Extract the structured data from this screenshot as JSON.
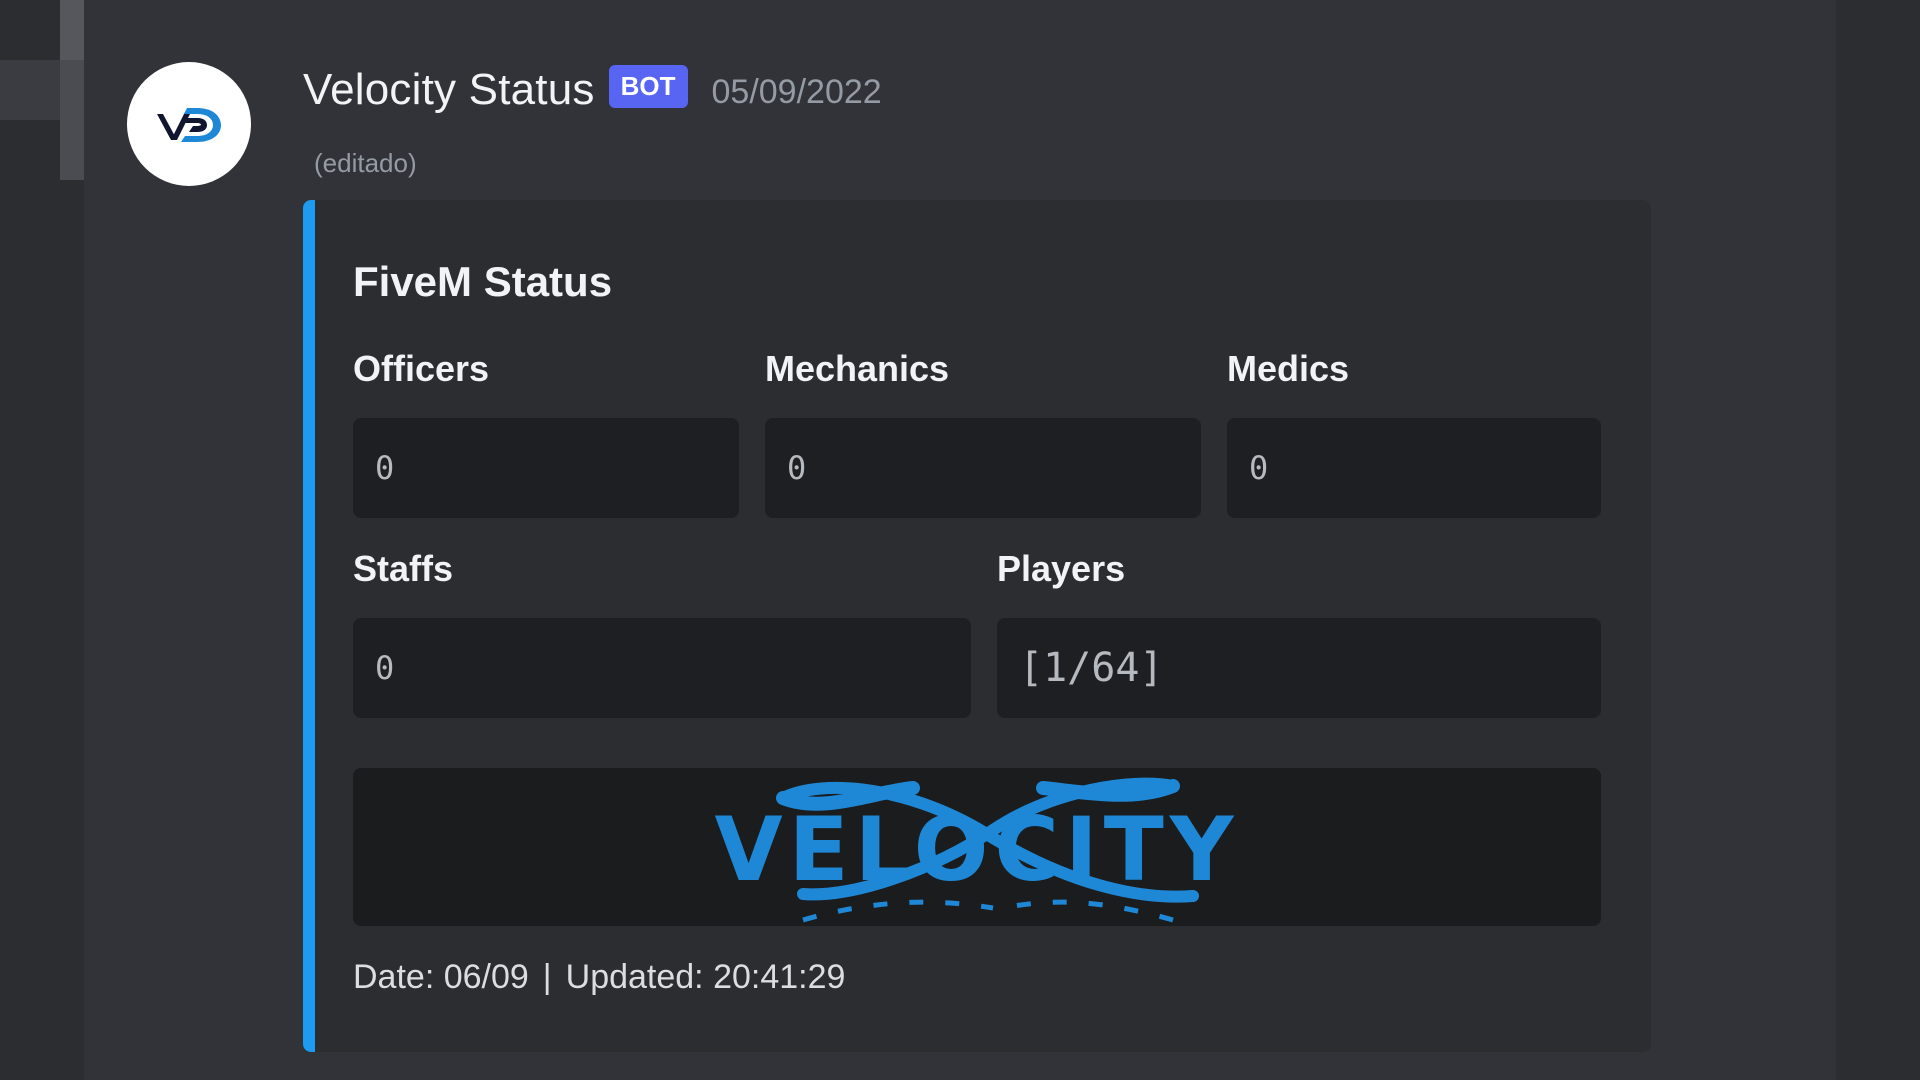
{
  "message": {
    "author": "Velocity Status",
    "badge": "BOT",
    "timestamp": "05/09/2022",
    "edited_label": "(editado)"
  },
  "embed": {
    "accent_color": "#1d9bf0",
    "title": "FiveM Status",
    "fields": {
      "officers": {
        "name": "Officers",
        "value": "0"
      },
      "mechanics": {
        "name": "Mechanics",
        "value": "0"
      },
      "medics": {
        "name": "Medics",
        "value": "0"
      },
      "staffs": {
        "name": "Staffs",
        "value": "0"
      },
      "players": {
        "name": "Players",
        "value": "[1/64]"
      }
    },
    "image_text": "VELOCITY",
    "footer": {
      "date": "Date: 06/09",
      "separator": "|",
      "updated": "Updated: 20:41:29"
    }
  },
  "colors": {
    "background": "#313338",
    "bot_badge": "#5865f2",
    "logo_blue": "#1e88d6"
  },
  "icons": {
    "avatar": "vd-logo-icon"
  }
}
